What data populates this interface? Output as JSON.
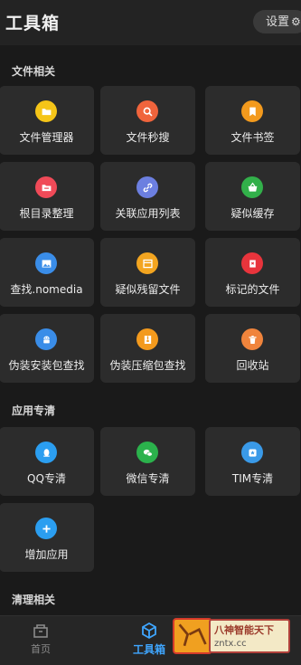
{
  "header": {
    "title": "工具箱",
    "settings_label": "设置",
    "settings_icon": "gear-icon"
  },
  "sections": [
    {
      "title": "文件相关"
    },
    {
      "title": "应用专清"
    },
    {
      "title": "清理相关"
    }
  ],
  "file_tools": [
    {
      "label": "文件管理器",
      "icon": "folder-icon",
      "color": "#f5c518"
    },
    {
      "label": "文件秒搜",
      "icon": "search-icon",
      "color": "#f0643c"
    },
    {
      "label": "文件书签",
      "icon": "bookmark-icon",
      "color": "#f39a1d"
    },
    {
      "label": "根目录整理",
      "icon": "folder-icon",
      "color": "#f04a58"
    },
    {
      "label": "关联应用列表",
      "icon": "link-icon",
      "color": "#6c7fe0"
    },
    {
      "label": "疑似缓存",
      "icon": "basket-icon",
      "color": "#32b04a"
    },
    {
      "label": "查找.nomedia",
      "icon": "image-icon",
      "color": "#3a8de8"
    },
    {
      "label": "疑似残留文件",
      "icon": "calendar-icon",
      "color": "#f3a520"
    },
    {
      "label": "标记的文件",
      "icon": "tag-icon",
      "color": "#e8343c"
    },
    {
      "label": "伪装安装包查找",
      "icon": "android-icon",
      "color": "#3a8de8"
    },
    {
      "label": "伪装压缩包查找",
      "icon": "archive-icon",
      "color": "#f39a1d"
    },
    {
      "label": "回收站",
      "icon": "trash-icon",
      "color": "#f0843c"
    }
  ],
  "app_tools": [
    {
      "label": "QQ专清",
      "icon": "qq-icon",
      "color": "#2b9ef0"
    },
    {
      "label": "微信专清",
      "icon": "wechat-icon",
      "color": "#2bb24c"
    },
    {
      "label": "TIM专清",
      "icon": "tim-icon",
      "color": "#3a9ae8"
    },
    {
      "label": "增加应用",
      "icon": "plus-icon",
      "color": "#2b9ef0"
    }
  ],
  "bottom_nav": [
    {
      "label": "首页",
      "icon": "home-icon",
      "active": false
    },
    {
      "label": "工具箱",
      "icon": "cube-icon",
      "active": true
    }
  ],
  "watermark": {
    "title": "八神智能天下",
    "url": "zntx.cc"
  },
  "colors": {
    "accent": "#3fa6ff",
    "background": "#1a1a1a",
    "card": "#2c2c2c"
  }
}
